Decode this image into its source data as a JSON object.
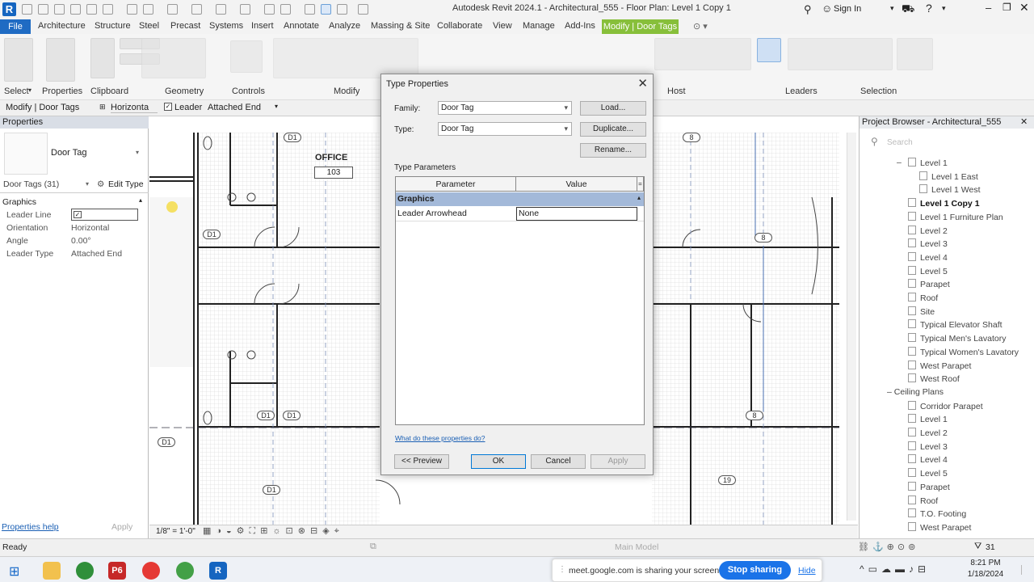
{
  "window": {
    "title": "Autodesk Revit 2024.1 - Architectural_555 - Floor Plan: Level 1 Copy 1",
    "sign_in": "Sign In"
  },
  "ribbon": {
    "tabs": [
      "File",
      "Architecture",
      "Structure",
      "Steel",
      "Precast",
      "Systems",
      "Insert",
      "Annotate",
      "Analyze",
      "Massing & Site",
      "Collaborate",
      "View",
      "Manage",
      "Add-Ins",
      "Modify | Door Tags"
    ],
    "panels": [
      "Select",
      "Properties",
      "Clipboard",
      "Geometry",
      "Controls",
      "Modify",
      "Host",
      "Leaders",
      "Selection"
    ]
  },
  "options_bar": {
    "context": "Modify | Door Tags",
    "orientation": "Horizonta",
    "leader_label": "Leader",
    "leader_checked": true,
    "leader_type": "Attached End"
  },
  "properties": {
    "header": "Properties",
    "type_name": "Door Tag",
    "selector": "Door Tags (31)",
    "edit_type": "Edit Type",
    "group": "Graphics",
    "rows": [
      {
        "label": "Leader Line",
        "value": ""
      },
      {
        "label": "Orientation",
        "value": "Horizontal"
      },
      {
        "label": "Angle",
        "value": "0.00°"
      },
      {
        "label": "Leader Type",
        "value": "Attached End"
      }
    ],
    "help_link": "Properties help",
    "apply": "Apply"
  },
  "canvas": {
    "room_name": "OFFICE",
    "room_number": "103",
    "scale": "1/8\" = 1'-0\"",
    "door_tag": "D1",
    "grid_labels": [
      "8",
      "8",
      "8",
      "19"
    ]
  },
  "project_browser": {
    "header": "Project Browser - Architectural_555",
    "search_placeholder": "Search",
    "items": [
      {
        "label": "Level 1",
        "bold": false
      },
      {
        "label": "Level 1 East",
        "bold": false
      },
      {
        "label": "Level 1 West",
        "bold": false
      },
      {
        "label": "Level 1 Copy 1",
        "bold": true
      },
      {
        "label": "Level 1 Furniture Plan",
        "bold": false
      },
      {
        "label": "Level 2",
        "bold": false
      },
      {
        "label": "Level 3",
        "bold": false
      },
      {
        "label": "Level 4",
        "bold": false
      },
      {
        "label": "Level 5",
        "bold": false
      },
      {
        "label": "Parapet",
        "bold": false
      },
      {
        "label": "Roof",
        "bold": false
      },
      {
        "label": "Site",
        "bold": false
      },
      {
        "label": "Typical Elevator Shaft",
        "bold": false
      },
      {
        "label": "Typical Men's Lavatory",
        "bold": false
      },
      {
        "label": "Typical Women's Lavatory",
        "bold": false
      },
      {
        "label": "West Parapet",
        "bold": false
      },
      {
        "label": "West Roof",
        "bold": false
      }
    ],
    "ceiling_header": "Ceiling Plans",
    "ceiling_items": [
      "Corridor Parapet",
      "Level 1",
      "Level 2",
      "Level 3",
      "Level 4",
      "Level 5",
      "Parapet",
      "Roof",
      "T.O. Footing",
      "West Parapet"
    ]
  },
  "dialog": {
    "title": "Type Properties",
    "family_label": "Family:",
    "family_value": "Door Tag",
    "type_label": "Type:",
    "type_value": "Door Tag",
    "load": "Load...",
    "duplicate": "Duplicate...",
    "rename": "Rename...",
    "type_params": "Type Parameters",
    "col_param": "Parameter",
    "col_value": "Value",
    "group": "Graphics",
    "row_param": "Leader Arrowhead",
    "row_value": "None",
    "help_link": "What do these properties do?",
    "preview": "<< Preview",
    "ok": "OK",
    "cancel": "Cancel",
    "apply": "Apply"
  },
  "status": {
    "text": "Ready",
    "main_model": "Main Model",
    "filter_count": "31"
  },
  "taskbar": {
    "time": "8:21 PM",
    "date": "1/18/2024",
    "share_text": "meet.google.com is sharing your screen.",
    "stop_sharing": "Stop sharing",
    "hide": "Hide"
  }
}
